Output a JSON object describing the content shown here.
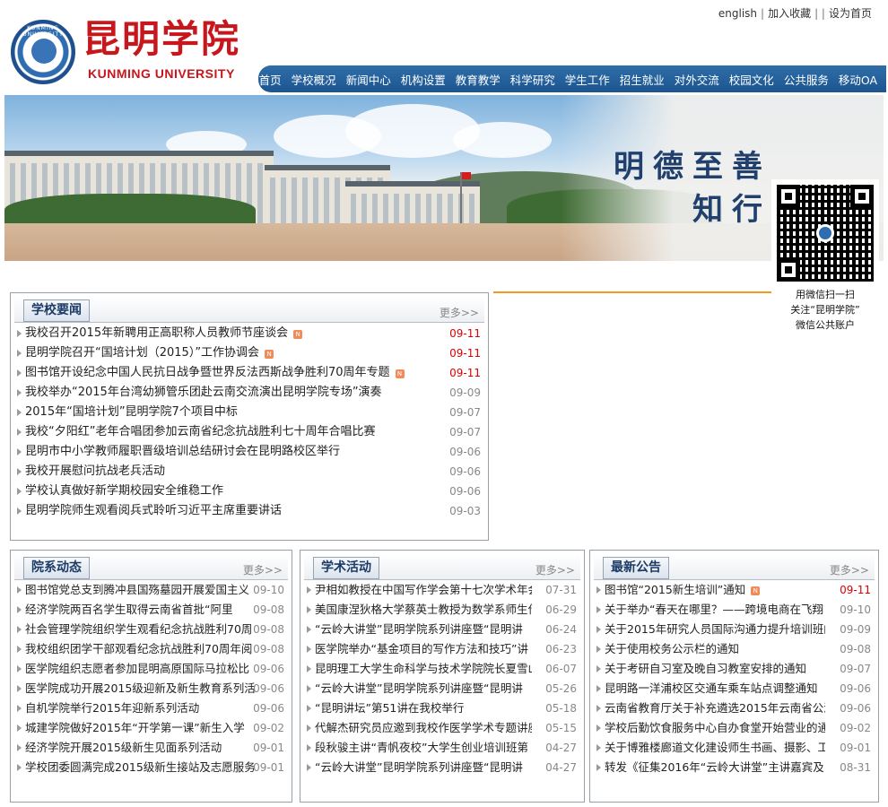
{
  "toplinks": {
    "english": "english",
    "fav": "加入收藏",
    "home": "设为首页"
  },
  "logo": {
    "cn": "昆明学院",
    "en": "KUNMING UNIVERSITY",
    "seal": "KUNMING UNIVERSITY"
  },
  "nav": [
    "首页",
    "学校概况",
    "新闻中心",
    "机构设置",
    "教育教学",
    "科学研究",
    "学生工作",
    "招生就业",
    "对外交流",
    "校园文化",
    "公共服务",
    "移动OA"
  ],
  "banner": {
    "motto1": "明德至善",
    "motto2": "知行"
  },
  "qr": {
    "line1": "用微信扫一扫",
    "line2": "关注“昆明学院”",
    "line3": "微信公共账户"
  },
  "news": {
    "title": "学校要闻",
    "more": "更多>>",
    "items": [
      {
        "t": "我校召开2015年新聘用正高职称人员教师节座谈会",
        "d": "09-11",
        "hot": true,
        "new": true
      },
      {
        "t": "昆明学院召开“国培计划（2015）”工作协调会",
        "d": "09-11",
        "hot": true,
        "new": true
      },
      {
        "t": "图书馆开设纪念中国人民抗日战争暨世界反法西斯战争胜利70周年专题",
        "d": "09-11",
        "hot": true,
        "new": true
      },
      {
        "t": "我校举办“2015年台湾幼狮管乐团赴云南交流演出昆明学院专场”演奏",
        "d": "09-09"
      },
      {
        "t": "2015年“国培计划”昆明学院7个项目中标",
        "d": "09-07"
      },
      {
        "t": "我校“夕阳红”老年合唱团参加云南省纪念抗战胜利七十周年合唱比赛",
        "d": "09-07"
      },
      {
        "t": "昆明市中小学教师履职晋级培训总结研讨会在昆明路校区举行",
        "d": "09-06"
      },
      {
        "t": "我校开展慰问抗战老兵活动",
        "d": "09-06"
      },
      {
        "t": "学校认真做好新学期校园安全维稳工作",
        "d": "09-06"
      },
      {
        "t": "昆明学院师生观看阅兵式聆听习近平主席重要讲话",
        "d": "09-03"
      }
    ]
  },
  "dept": {
    "title": "院系动态",
    "more": "更多>>",
    "items": [
      {
        "t": "图书馆党总支到腾冲县国殇墓园开展爱国主义",
        "d": "09-10"
      },
      {
        "t": "经济学院两百名学生取得云南省首批“阿里",
        "d": "09-08"
      },
      {
        "t": "社会管理学院组织学生观看纪念抗战胜利70周",
        "d": "09-08"
      },
      {
        "t": "我校组织团学干部观看纪念抗战胜利70周年阅",
        "d": "09-08"
      },
      {
        "t": "医学院组织志愿者参加昆明高原国际马拉松比",
        "d": "09-06"
      },
      {
        "t": "医学院成功开展2015级迎新及新生教育系列活",
        "d": "09-06"
      },
      {
        "t": "自机学院举行2015年迎新系列活动",
        "d": "09-06"
      },
      {
        "t": "城建学院做好2015年“开学第一课”新生入学",
        "d": "09-02"
      },
      {
        "t": "经济学院开展2015级新生见面系列活动",
        "d": "09-01"
      },
      {
        "t": "学校团委圆满完成2015级新生接站及志愿服务",
        "d": "09-01"
      }
    ]
  },
  "academic": {
    "title": "学术活动",
    "more": "更多>>",
    "items": [
      {
        "t": "尹相如教授在中国写作学会第十七次学术年会",
        "d": "07-31"
      },
      {
        "t": "美国康涅狄格大学蔡英士教授为数学系师生作",
        "d": "06-29"
      },
      {
        "t": "“云岭大讲堂”昆明学院系列讲座暨“昆明讲",
        "d": "06-24"
      },
      {
        "t": "医学院举办“基金项目的写作方法和技巧”讲",
        "d": "06-23"
      },
      {
        "t": "昆明理工大学生命科学与技术学院院长夏雪山",
        "d": "06-07"
      },
      {
        "t": "“云岭大讲堂”昆明学院系列讲座暨“昆明讲",
        "d": "05-26"
      },
      {
        "t": "“昆明讲坛”第51讲在我校举行",
        "d": "05-18"
      },
      {
        "t": "代解杰研究员应邀到我校作医学学术专题讲座",
        "d": "05-15"
      },
      {
        "t": "段秋骏主讲“青帆夜校”大学生创业培训班第",
        "d": "04-27"
      },
      {
        "t": "“云岭大讲堂”昆明学院系列讲座暨“昆明讲",
        "d": "04-27"
      }
    ]
  },
  "notice": {
    "title": "最新公告",
    "more": "更多>>",
    "items": [
      {
        "t": "图书馆“2015新生培训”通知",
        "d": "09-11",
        "hot": true,
        "new": true
      },
      {
        "t": "关于举办“春天在哪里？——跨境电商在飞翔",
        "d": "09-10"
      },
      {
        "t": "关于2015年研究人员国际沟通力提升培训班的",
        "d": "09-09"
      },
      {
        "t": "关于使用校务公示栏的通知",
        "d": "09-08"
      },
      {
        "t": "关于考研自习室及晚自习教室安排的通知",
        "d": "09-07"
      },
      {
        "t": "昆明路一洋浦校区交通车乘车站点调整通知",
        "d": "09-06"
      },
      {
        "t": "云南省教育厅关于补充遴选2015年云南省公派",
        "d": "09-06"
      },
      {
        "t": "学校后勤饮食服务中心自办食堂开始营业的通",
        "d": "09-02"
      },
      {
        "t": "关于博雅楼廊道文化建设师生书画、摄影、工",
        "d": "09-01"
      },
      {
        "t": "转发《征集2016年“云岭大讲堂”主讲嘉宾及",
        "d": "08-31"
      }
    ]
  },
  "colors": {
    "nav": "#2f6ea8",
    "brand": "#c8161d",
    "hot_date": "#dd0000",
    "accent_line": "#f19a1e"
  }
}
